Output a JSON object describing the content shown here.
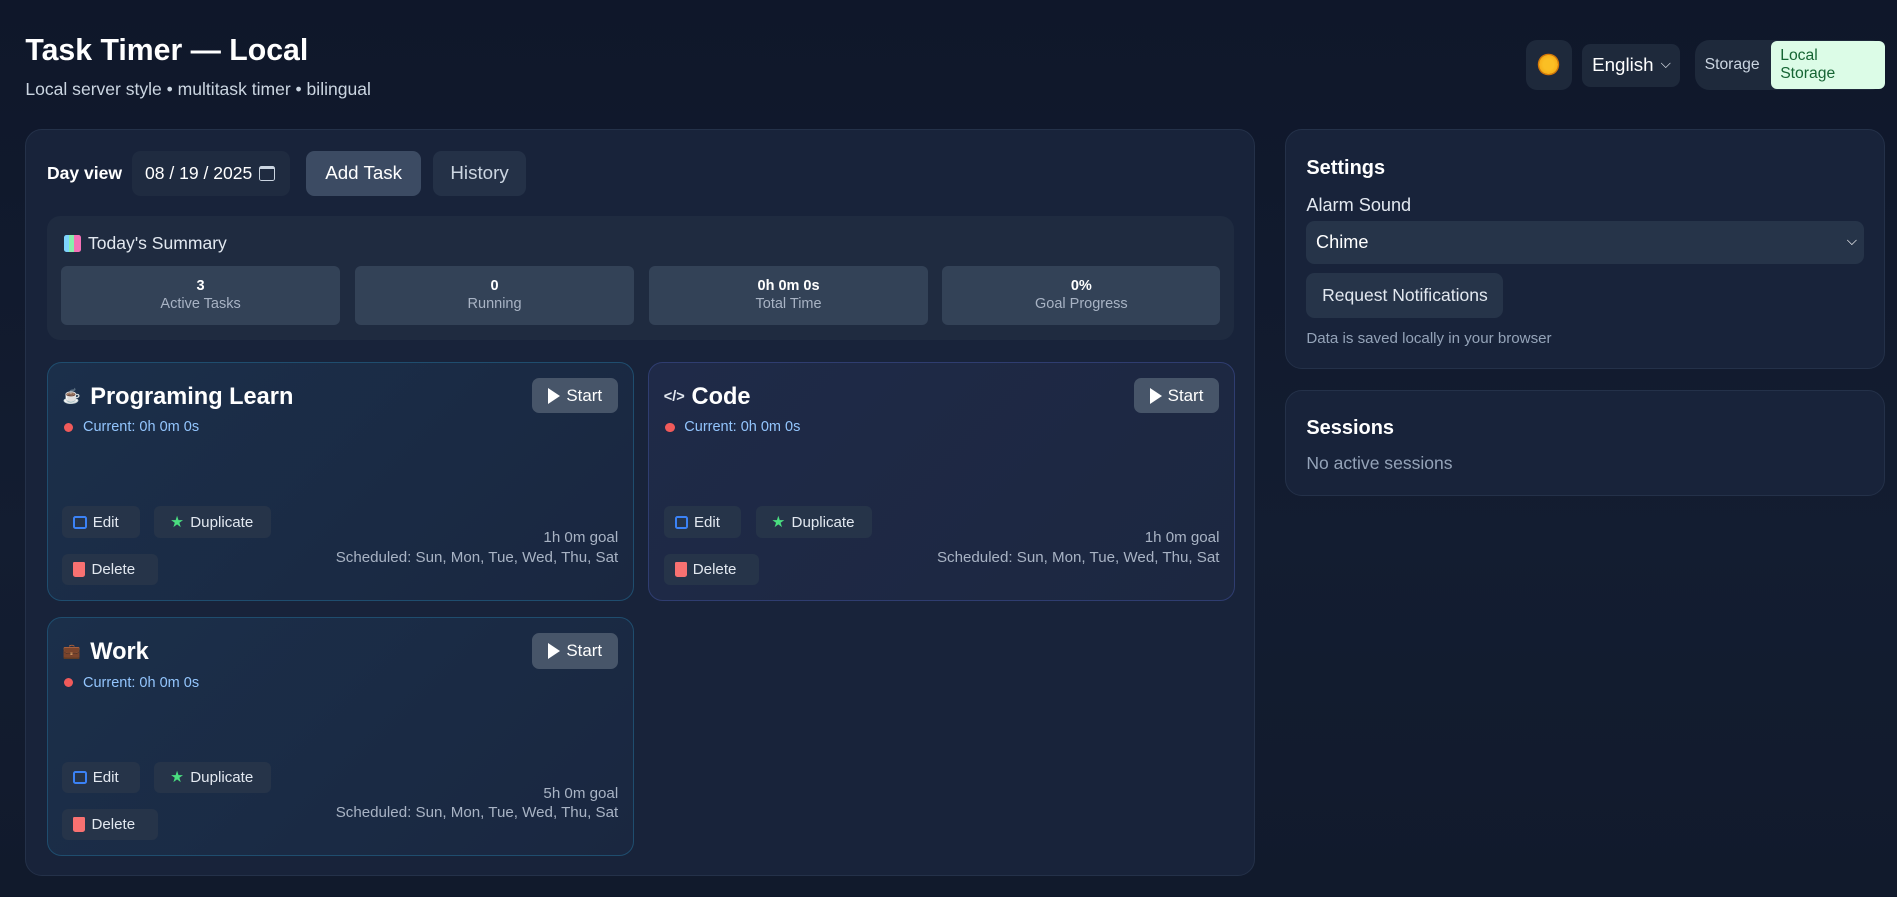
{
  "header": {
    "title": "Task Timer — Local",
    "subtitle": "Local server style • multitask timer • bilingual",
    "theme_icon": "sun-icon",
    "language": "English",
    "storage_label": "Storage",
    "storage_value": "Local Storage"
  },
  "toolbar": {
    "day_view": "Day view",
    "date": "08 / 19 / 2025",
    "add_task": "Add Task",
    "history": "History"
  },
  "summary": {
    "title": "Today's Summary",
    "stats": [
      {
        "value": "3",
        "label": "Active Tasks"
      },
      {
        "value": "0",
        "label": "Running"
      },
      {
        "value": "0h 0m 0s",
        "label": "Total Time"
      },
      {
        "value": "0%",
        "label": "Goal Progress"
      }
    ]
  },
  "tasks": [
    {
      "name": "Programing Learn",
      "icon": "coffee-icon",
      "current": "Current: 0h 0m 0s",
      "start": "Start",
      "edit": "Edit",
      "duplicate": "Duplicate",
      "delete": "Delete",
      "goal": "1h 0m goal",
      "scheduled": "Scheduled: Sun, Mon, Tue, Wed, Thu, Sat"
    },
    {
      "name": "Code",
      "icon": "code-icon",
      "current": "Current: 0h 0m 0s",
      "start": "Start",
      "edit": "Edit",
      "duplicate": "Duplicate",
      "delete": "Delete",
      "goal": "1h 0m goal",
      "scheduled": "Scheduled: Sun, Mon, Tue, Wed, Thu, Sat"
    },
    {
      "name": "Work",
      "icon": "briefcase-icon",
      "current": "Current: 0h 0m 0s",
      "start": "Start",
      "edit": "Edit",
      "duplicate": "Duplicate",
      "delete": "Delete",
      "goal": "5h 0m goal",
      "scheduled": "Scheduled: Sun, Mon, Tue, Wed, Thu, Sat"
    }
  ],
  "settings": {
    "title": "Settings",
    "alarm_label": "Alarm Sound",
    "alarm_value": "Chime",
    "request_notifications": "Request Notifications",
    "note": "Data is saved locally in your browser"
  },
  "sessions": {
    "title": "Sessions",
    "empty": "No active sessions"
  },
  "colors": {
    "background": "#0f172a",
    "badge_bg": "#dcfce7",
    "badge_text": "#166534",
    "status_dot": "#f05a5a",
    "current_text": "#93c5fd"
  }
}
